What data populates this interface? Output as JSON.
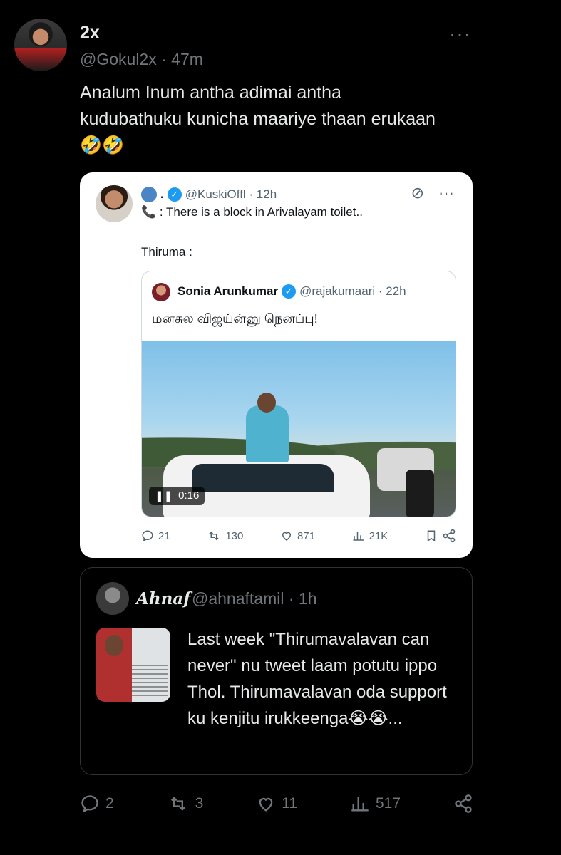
{
  "header": {
    "name": "2x",
    "handle": "@Gokul2x · 47m",
    "more": "···"
  },
  "tweet": {
    "text": "Analum Inum antha adimai antha kudubathuku kunicha maariye thaan erukaan 🤣🤣"
  },
  "screenshot_card": {
    "handle": "@KuskiOffl · 12h",
    "line1": "📞 : There is a block in Arivalayam toilet..",
    "line2": "Thiruma :",
    "inner": {
      "name": "Sonia Arunkumar",
      "handle": "@rajakumaari · 22h",
      "text": "மனசுல விஜய்ன்னு நெனப்பு!",
      "video_time": "0:16"
    },
    "actions": {
      "replies": "21",
      "reposts": "130",
      "likes": "871",
      "views": "21K"
    }
  },
  "quote_card": {
    "name": "Ahnaf",
    "handle": "@ahnaftamil · 1h",
    "text": "Last week \"Thirumavalavan can never\" nu tweet laam potutu ippo Thol. Thirumavalavan oda support ku kenjitu irukkeenga😭😭..."
  },
  "actions": {
    "replies": "2",
    "reposts": "3",
    "likes": "11",
    "views": "517"
  }
}
